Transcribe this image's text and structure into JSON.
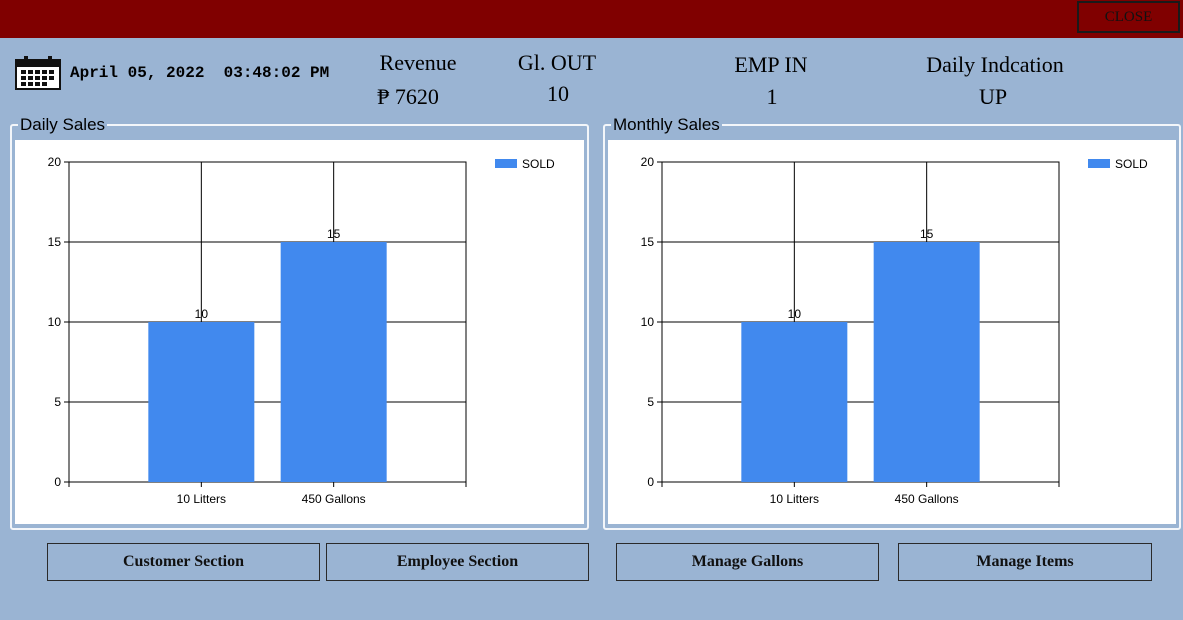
{
  "header": {
    "close_label": "CLOSE"
  },
  "datetime": {
    "date": "April 05, 2022",
    "time": "03:48:02 PM"
  },
  "stats": [
    {
      "label": "Revenue",
      "value": "₱ 7620"
    },
    {
      "label": "Gl. OUT",
      "value": "10"
    },
    {
      "label": "EMP IN",
      "value": "1"
    },
    {
      "label": "Daily Indcation",
      "value": "UP"
    }
  ],
  "panels": {
    "daily_title": "Daily Sales",
    "monthly_title": "Monthly Sales"
  },
  "chart_data": [
    {
      "type": "bar",
      "title": "Daily Sales",
      "categories": [
        "10 Litters",
        "450 Gallons"
      ],
      "series": [
        {
          "name": "SOLD",
          "values": [
            10,
            15
          ],
          "color": "#4189ee"
        }
      ],
      "ylim": [
        0,
        20
      ],
      "yticks": [
        0,
        5,
        10,
        15,
        20
      ],
      "grid": true,
      "legend": "top-right"
    },
    {
      "type": "bar",
      "title": "Monthly Sales",
      "categories": [
        "10 Litters",
        "450 Gallons"
      ],
      "series": [
        {
          "name": "SOLD",
          "values": [
            10,
            15
          ],
          "color": "#4189ee"
        }
      ],
      "ylim": [
        0,
        20
      ],
      "yticks": [
        0,
        5,
        10,
        15,
        20
      ],
      "grid": true,
      "legend": "top-right"
    }
  ],
  "buttons": {
    "customer": "Customer Section",
    "employee": "Employee Section",
    "gallons": "Manage Gallons",
    "items": "Manage Items"
  },
  "icons": {
    "calendar": "calendar-icon"
  }
}
